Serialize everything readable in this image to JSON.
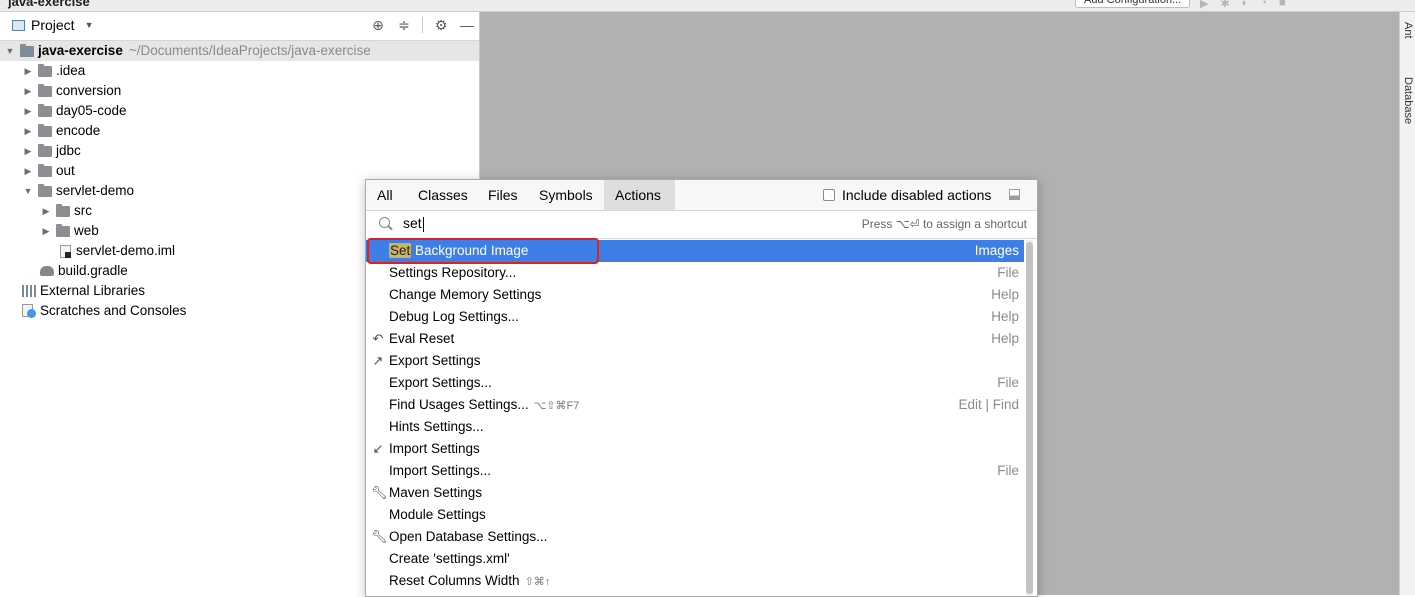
{
  "window": {
    "title": "java-exercise",
    "add_config_label": "Add Configuration..."
  },
  "project_panel": {
    "title": "Project",
    "tree": [
      {
        "label": "java-exercise",
        "path": "~/Documents/IdeaProjects/java-exercise",
        "expanded": true
      },
      {
        "label": ".idea"
      },
      {
        "label": "conversion"
      },
      {
        "label": "day05-code"
      },
      {
        "label": "encode"
      },
      {
        "label": "jdbc"
      },
      {
        "label": "out"
      },
      {
        "label": "servlet-demo",
        "expanded": true
      },
      {
        "label": "src"
      },
      {
        "label": "web"
      },
      {
        "label": "servlet-demo.iml"
      },
      {
        "label": "build.gradle"
      },
      {
        "label": "External Libraries"
      },
      {
        "label": "Scratches and Consoles"
      }
    ]
  },
  "right_strip": {
    "items": [
      "Ant",
      "Database"
    ]
  },
  "search_popup": {
    "tabs": [
      "All",
      "Classes",
      "Files",
      "Symbols",
      "Actions"
    ],
    "active_tab": "Actions",
    "include_disabled_label": "Include disabled actions",
    "include_disabled_checked": false,
    "query": "set",
    "shortcut_hint": "Press ⌥⏎ to assign a shortcut",
    "results": [
      {
        "match": "Set",
        "rest": " Background Image",
        "category": "Images",
        "selected": true
      },
      {
        "label": "Settings Repository...",
        "category": "File"
      },
      {
        "label": "Change Memory Settings",
        "category": "Help"
      },
      {
        "label": "Debug Log Settings...",
        "category": "Help"
      },
      {
        "label": "Eval Reset",
        "category": "Help",
        "icon": "undo-icon"
      },
      {
        "label": "Export Settings",
        "category": "",
        "icon": "export-icon"
      },
      {
        "label": "Export Settings...",
        "category": "File"
      },
      {
        "label": "Find Usages Settings...",
        "shortcut": "⌥⇧⌘F7",
        "category": "Edit | Find"
      },
      {
        "label": "Hints Settings...",
        "category": ""
      },
      {
        "label": "Import Settings",
        "category": "",
        "icon": "import-icon"
      },
      {
        "label": "Import Settings...",
        "category": "File"
      },
      {
        "label": "Maven Settings",
        "category": "",
        "icon": "wrench-icon"
      },
      {
        "label": "Module Settings",
        "category": ""
      },
      {
        "label": "Open Database Settings...",
        "category": "",
        "icon": "wrench-icon"
      },
      {
        "label": "Create 'settings.xml'",
        "category": ""
      },
      {
        "label": "Reset Columns Width",
        "shortcut": "⇧⌘↑",
        "category": ""
      }
    ]
  }
}
